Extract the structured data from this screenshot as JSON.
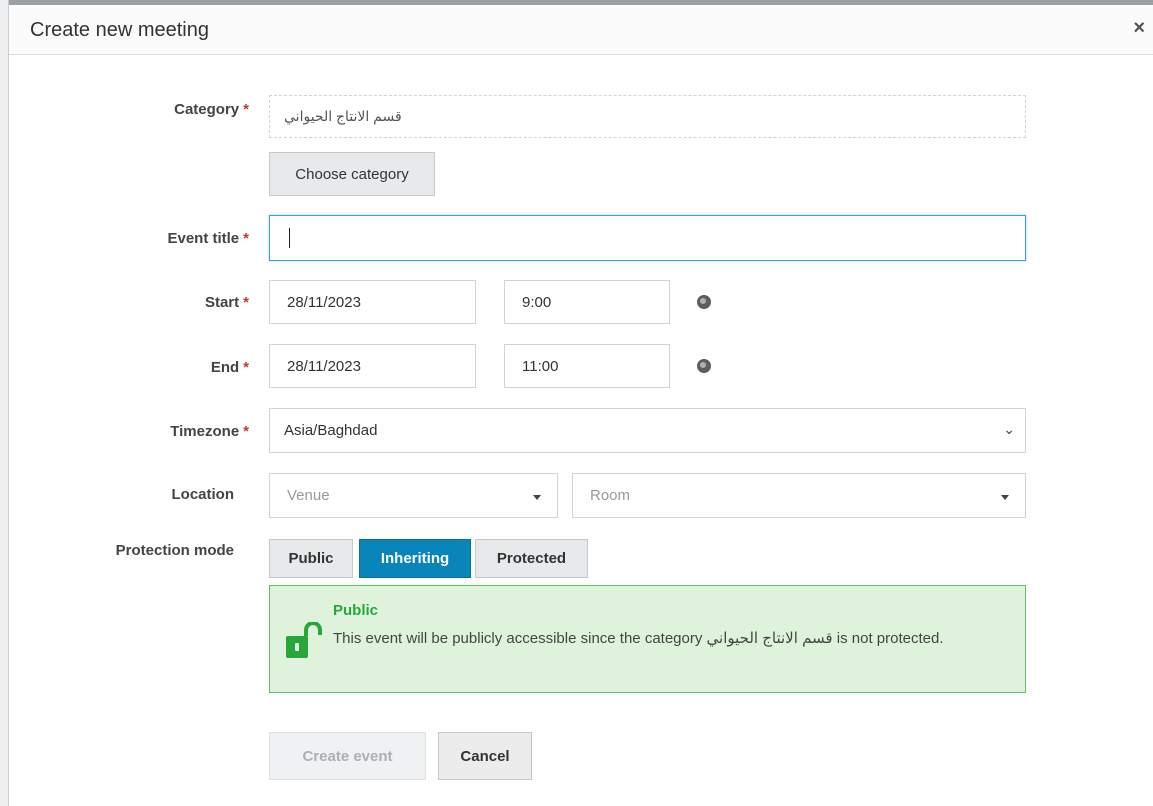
{
  "dialog": {
    "title": "Create new meeting",
    "close_icon": "×"
  },
  "category": {
    "label": "Category",
    "required": "*",
    "value": "قسم الانتاج الحيواني",
    "choose_button": "Choose category"
  },
  "event_title": {
    "label": "Event title",
    "required": "*",
    "value": ""
  },
  "start": {
    "label": "Start",
    "required": "*",
    "date": "28/11/2023",
    "time": "9:00"
  },
  "end": {
    "label": "End",
    "required": "*",
    "date": "28/11/2023",
    "time": "11:00"
  },
  "timezone": {
    "label": "Timezone",
    "required": "*",
    "value": "Asia/Baghdad"
  },
  "location": {
    "label": "Location",
    "venue_placeholder": "Venue",
    "room_placeholder": "Room"
  },
  "protection": {
    "label": "Protection mode",
    "options": [
      "Public",
      "Inheriting",
      "Protected"
    ],
    "selected": "Inheriting",
    "notice_title": "Public",
    "notice_text": "This event will be publicly accessible since the category قسم الانتاج الحيواني is not protected."
  },
  "actions": {
    "create_label": "Create event",
    "cancel_label": "Cancel"
  },
  "colors": {
    "accent": "#0a85b9",
    "required": "#c0392b",
    "success": "#27a63a",
    "success_bg": "#dff3dc"
  }
}
